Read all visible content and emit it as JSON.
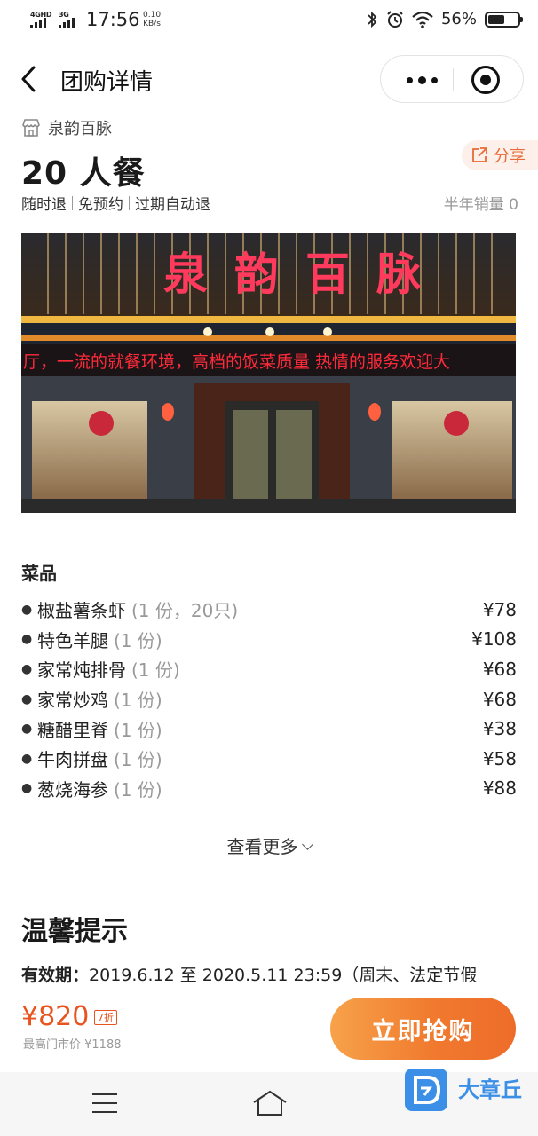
{
  "status_bar": {
    "network1": "4GHD",
    "network2": "3G",
    "time": "17:56",
    "speed_value": "0.10",
    "speed_unit": "KB/s",
    "battery": "56%",
    "battery_level": 0.56
  },
  "header": {
    "title": "团购详情"
  },
  "deal": {
    "shop_name": "泉韵百脉",
    "title": "20 人餐",
    "share_label": "分享",
    "tags": [
      "随时退",
      "免预约",
      "过期自动退"
    ],
    "sales": "半年销量 0"
  },
  "hero_image": {
    "sign_text": "泉韵百脉",
    "marquee_text": "厅，一流的就餐环境，高档的饭菜质量   热情的服务欢迎大"
  },
  "dishes": {
    "section_title": "菜品",
    "items": [
      {
        "name": "椒盐薯条虾",
        "qty": "(1 份，20只)",
        "price": "¥78"
      },
      {
        "name": "特色羊腿",
        "qty": "(1 份)",
        "price": "¥108"
      },
      {
        "name": "家常炖排骨",
        "qty": "(1 份)",
        "price": "¥68"
      },
      {
        "name": "家常炒鸡",
        "qty": "(1 份)",
        "price": "¥68"
      },
      {
        "name": "糖醋里脊",
        "qty": "(1 份)",
        "price": "¥38"
      },
      {
        "name": "牛肉拼盘",
        "qty": "(1 份)",
        "price": "¥58"
      },
      {
        "name": "葱烧海参",
        "qty": "(1 份)",
        "price": "¥88"
      }
    ],
    "see_more": "查看更多"
  },
  "tips": {
    "title": "温馨提示",
    "validity_label": "有效期：",
    "validity_value": "2019.6.12 至 2020.5.11 23:59（周末、法定节假"
  },
  "buy_bar": {
    "price": "¥820",
    "discount": "7折",
    "original_price": "最高门市价 ¥1188",
    "buy_label": "立即抢购"
  },
  "watermark": {
    "text": "大章丘"
  },
  "colors": {
    "accent": "#e8531e",
    "button_gradient_start": "#f7a24a",
    "button_gradient_end": "#ee6c2a",
    "share_bg": "#fdf0ea"
  }
}
